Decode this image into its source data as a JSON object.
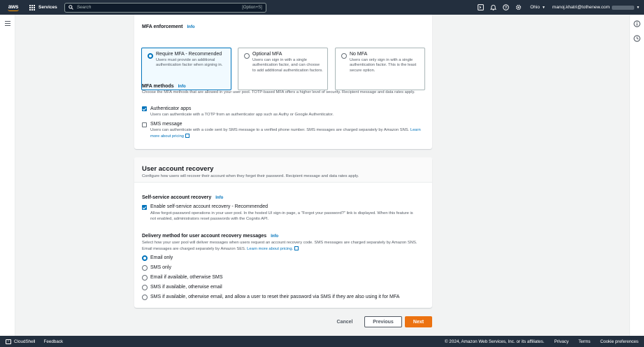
{
  "topnav": {
    "logo_text": "aws",
    "services_label": "Services",
    "search_placeholder": "Search",
    "search_shortcut": "[Option+S]",
    "region": "Ohio",
    "account": "manoj.khatri@tothenew.com"
  },
  "mfa": {
    "enforcement_label": "MFA enforcement",
    "info": "Info",
    "options": [
      {
        "title": "Require MFA - Recommended",
        "desc": "Users must provide an additional authentication factor when signing in.",
        "selected": true
      },
      {
        "title": "Optional MFA",
        "desc": "Users can sign in with a single authentication factor, and can choose to add additional authentication factors.",
        "selected": false
      },
      {
        "title": "No MFA",
        "desc": "Users can only sign in with a single authentication factor. This is the least secure option.",
        "selected": false
      }
    ],
    "methods_label": "MFA methods",
    "methods_desc": "Choose the MFA methods that are allowed in your user pool. TOTP-based MFA offers a higher level of security. Recipient message and data rates apply.",
    "authenticator": {
      "label": "Authenticator apps",
      "desc": "Users can authenticate with a TOTP from an authenticator app such as Authy or Google Authenticator.",
      "checked": true
    },
    "sms": {
      "label": "SMS message",
      "desc": "Users can authenticate with a code sent by SMS message to a verified phone number. SMS messages are charged separately by Amazon SNS.",
      "link": "Learn more about pricing",
      "checked": false
    }
  },
  "recovery": {
    "title": "User account recovery",
    "subtitle": "Configure how users will recover their account when they forget their password. Recipient message and data rates apply.",
    "self_service_label": "Self-service account recovery",
    "info": "Info",
    "enable_label": "Enable self-service account recovery - Recommended",
    "enable_desc": "Allow forgot-password operations in your user pool. In the hosted UI sign-in page, a \"Forgot your password?\" link is displayed. When this feature is not enabled, administrators reset passwords with the Cognito API.",
    "delivery_label": "Delivery method for user account recovery messages",
    "delivery_desc": "Select how your user pool will deliver messages when users request an account recovery code. SMS messages are charged separately by Amazon SNS. Email messages are charged separately by Amazon SES.",
    "delivery_link": "Learn more about pricing.",
    "methods": [
      {
        "label": "Email only",
        "selected": true
      },
      {
        "label": "SMS only",
        "selected": false
      },
      {
        "label": "Email if available, otherwise SMS",
        "selected": false
      },
      {
        "label": "SMS if available, otherwise email",
        "selected": false
      },
      {
        "label": "SMS if available, otherwise email, and allow a user to reset their password via SMS if they are also using it for MFA",
        "selected": false
      }
    ]
  },
  "actions": {
    "cancel": "Cancel",
    "previous": "Previous",
    "next": "Next"
  },
  "footer": {
    "cloudshell": "CloudShell",
    "feedback": "Feedback",
    "copyright": "© 2024, Amazon Web Services, Inc. or its affiliates.",
    "privacy": "Privacy",
    "terms": "Terms",
    "cookies": "Cookie preferences"
  },
  "colors": {
    "accent": "#0073bb",
    "primary_button": "#ec7211",
    "nav_bg": "#232f3e"
  }
}
